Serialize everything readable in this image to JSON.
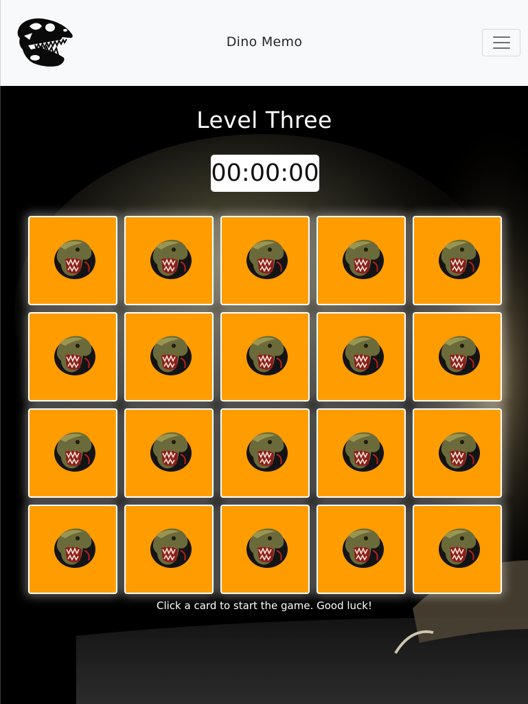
{
  "navbar": {
    "brand": "Dino Memo",
    "logo_icon": "trex-skull-icon",
    "menu_icon": "hamburger-menu-icon"
  },
  "game": {
    "level_title": "Level Three",
    "timer": "00:00:00",
    "card_back_icon": "trex-head-icon",
    "card_color": "#ff9c00",
    "grid": {
      "rows": 4,
      "columns": 5,
      "card_count": 20
    },
    "instruction": "Click a card to start the game. Good luck!"
  }
}
